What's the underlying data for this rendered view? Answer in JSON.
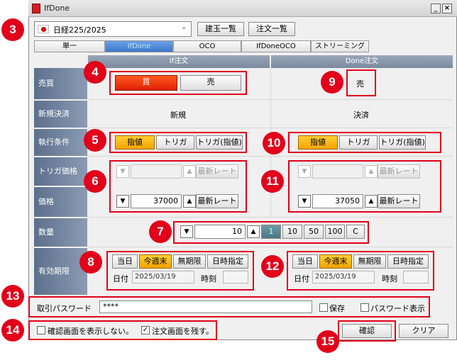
{
  "window": {
    "title": "IfDone"
  },
  "toolbar": {
    "symbol": "日経225/2025",
    "position_list": "建玉一覧",
    "order_list": "注文一覧"
  },
  "tabs": [
    "単一",
    "IfDone",
    "OCO",
    "IfDoneOCO",
    "ストリーミング"
  ],
  "headers": {
    "if": "If注文",
    "done": "Done注文"
  },
  "labels": {
    "side": "売買",
    "new_close": "新規決済",
    "exec": "執行条件",
    "trigger_price": "トリガ価格",
    "price": "価格",
    "qty": "数量",
    "expiry": "有効期限"
  },
  "if_order": {
    "buy": "買",
    "sell": "売",
    "new_close_value": "新規",
    "exec": [
      "指値",
      "トリガ",
      "トリガ(指値)"
    ],
    "latest_rate": "最新レート",
    "price": "37000"
  },
  "done_order": {
    "side": "売",
    "new_close_value": "決済",
    "exec": [
      "指値",
      "トリガ",
      "トリガ(指値)"
    ],
    "latest_rate": "最新レート",
    "price": "37050"
  },
  "quantity": {
    "value": "10",
    "presets": [
      "1",
      "10",
      "50",
      "100",
      "C"
    ]
  },
  "expiry": {
    "options": [
      "当日",
      "今週末",
      "無期限",
      "日時指定"
    ],
    "date_label": "日付",
    "date": "2025/03/19",
    "time_label": "時刻"
  },
  "password": {
    "label": "取引パスワード",
    "value": "****",
    "save": "保存",
    "show": "パスワード表示"
  },
  "bottom": {
    "hide_confirm": "確認画面を表示しない。",
    "keep_order": "注文画面を残す。"
  },
  "actions": {
    "confirm": "確認",
    "clear": "クリア"
  },
  "badges": [
    "3",
    "4",
    "5",
    "6",
    "7",
    "8",
    "9",
    "10",
    "11",
    "12",
    "13",
    "14",
    "15"
  ],
  "colors": {
    "selected": "#f5a300",
    "buy": "#e02000",
    "annotation": "#e2001a",
    "active_tab": "#3e78c8"
  }
}
